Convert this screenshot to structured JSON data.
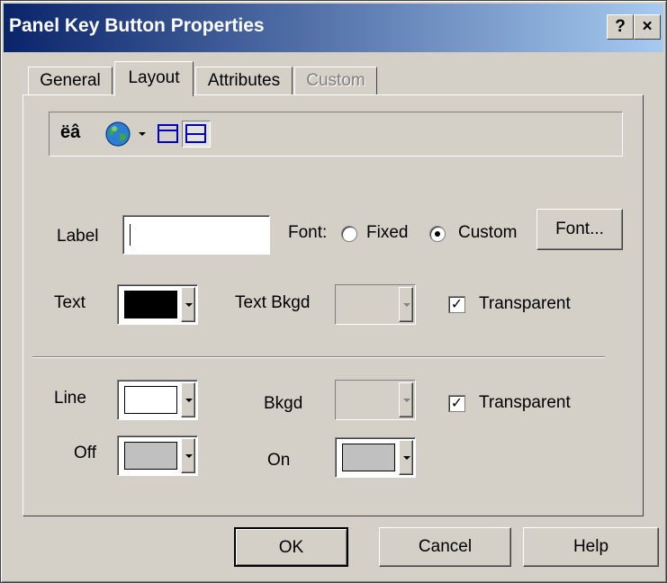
{
  "window": {
    "title": "Panel Key Button Properties",
    "help_label": "?",
    "close_label": "×"
  },
  "tabs": [
    {
      "label": "General"
    },
    {
      "label": "Layout",
      "active": true
    },
    {
      "label": "Attributes"
    },
    {
      "label": "Custom",
      "disabled": true
    }
  ],
  "toolbar": {
    "lang_label": "ëâ",
    "icons": [
      "globe-icon",
      "dropdown-arrow-icon",
      "layout-top-icon",
      "layout-middle-icon"
    ]
  },
  "form": {
    "label_label": "Label",
    "label_value": "",
    "font_label": "Font:",
    "font_options": [
      {
        "label": "Fixed",
        "selected": false
      },
      {
        "label": "Custom",
        "selected": true
      }
    ],
    "font_button": "Font...",
    "text_label": "Text",
    "text_color": "#000000",
    "text_bkgd_label": "Text Bkgd",
    "text_transparent_label": "Transparent",
    "text_transparent_checked": true,
    "line_label": "Line",
    "line_color": "#ffffff",
    "bkgd_label": "Bkgd",
    "bkgd_transparent_label": "Transparent",
    "bkgd_transparent_checked": true,
    "off_label": "Off",
    "off_color": "#c0c0c0",
    "on_label": "On",
    "on_color": "#c0c0c0"
  },
  "buttons": {
    "ok": "OK",
    "cancel": "Cancel",
    "help": "Help"
  }
}
